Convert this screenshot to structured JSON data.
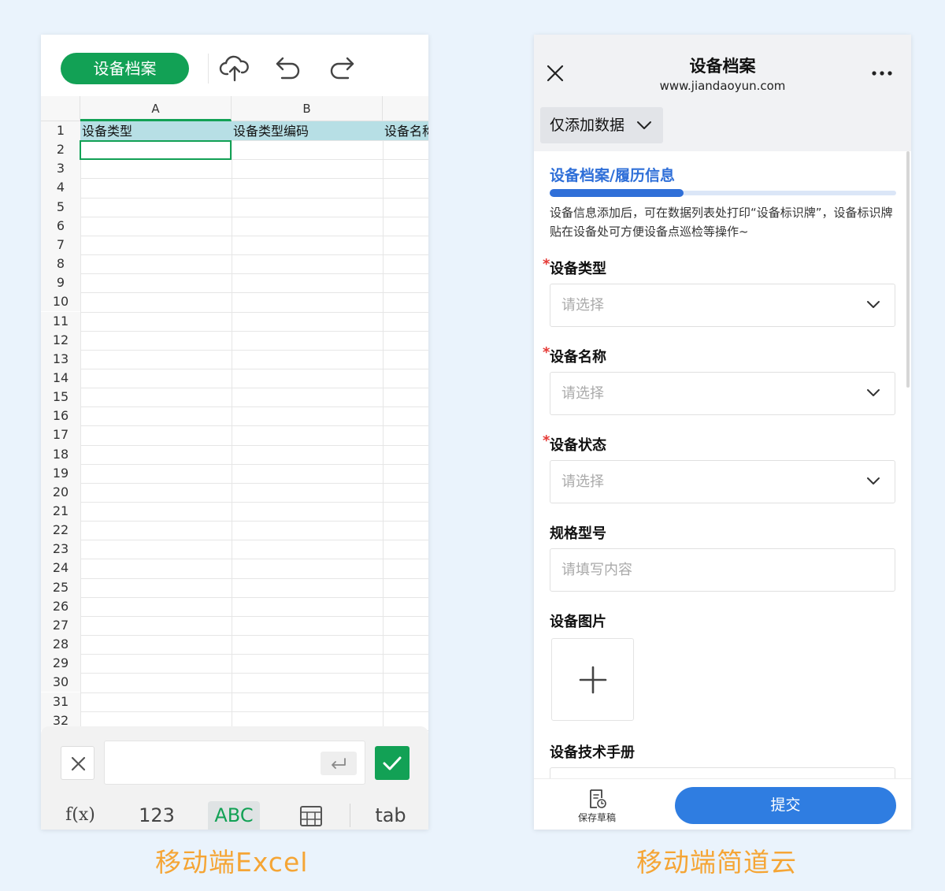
{
  "excel": {
    "title_button": "设备档案",
    "columns": [
      {
        "letter": "A"
      },
      {
        "letter": "B"
      }
    ],
    "header_row": [
      "设备类型",
      "设备类型编码",
      "设备名称"
    ],
    "row_numbers": [
      "1",
      "2",
      "3",
      "4",
      "5",
      "6",
      "7",
      "8",
      "9",
      "10",
      "11",
      "12",
      "13",
      "14",
      "15",
      "16",
      "17",
      "18",
      "19",
      "20",
      "21",
      "22",
      "23",
      "24",
      "25",
      "26",
      "27",
      "28",
      "29",
      "30",
      "31",
      "32"
    ],
    "keyboard_tabs": [
      "f(x)",
      "123",
      "ABC",
      "tab"
    ],
    "active_tab": "ABC",
    "colors": {
      "brand": "#12a155",
      "header_fill": "#b7dfe5"
    }
  },
  "jdy": {
    "title": "设备档案",
    "url": "www.jiandaoyun.com",
    "add_only": "仅添加数据",
    "section_title": "设备档案/履历信息",
    "description": "设备信息添加后，可在数据列表处打印“设备标识牌”，设备标识牌贴在设备处可方便设备点巡检等操作~",
    "fields": [
      {
        "label": "设备类型",
        "required": "*",
        "placeholder": "请选择"
      },
      {
        "label": "设备名称",
        "required": "*",
        "placeholder": "请选择"
      },
      {
        "label": "设备状态",
        "required": "*",
        "placeholder": "请选择"
      },
      {
        "label": "规格型号",
        "placeholder": "请填写内容"
      }
    ],
    "image_label": "设备图片",
    "manual_label": "设备技术手册",
    "draft_label": "保存草稿",
    "submit_label": "提交",
    "colors": {
      "accent": "#2f7de1",
      "required": "#e53935"
    }
  },
  "captions": {
    "left": "移动端Excel",
    "right": "移动端简道云"
  }
}
